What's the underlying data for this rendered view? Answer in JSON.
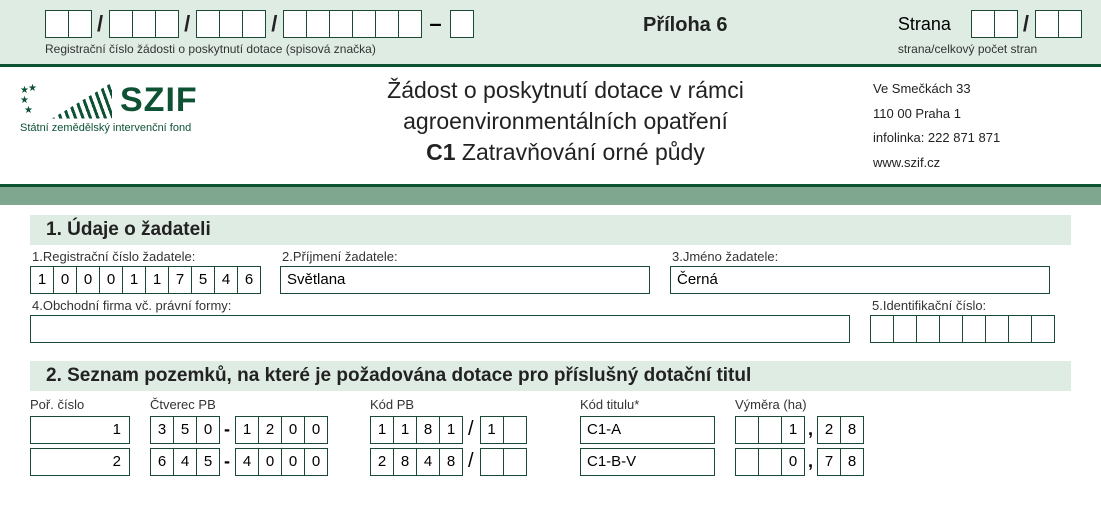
{
  "header": {
    "reg_caption": "Registrační číslo žádosti o poskytnutí dotace (spisová značka)",
    "priloha": "Příloha 6",
    "strana_label": "Strana",
    "strana_caption": "strana/celkový počet stran"
  },
  "logo": {
    "text": "SZIF",
    "sub": "Státní zemědělský intervenční fond"
  },
  "title": {
    "line1": "Žádost o poskytnutí dotace v rámci",
    "line2": "agroenvironmentálních opatření",
    "code": "C1",
    "line3_rest": " Zatravňování orné půdy"
  },
  "address": {
    "l1": "Ve Smečkách 33",
    "l2": "110 00 Praha 1",
    "l3": "infolinka: 222 871 871",
    "l4": "www.szif.cz"
  },
  "sec1": {
    "title": "1. Údaje o žadateli",
    "f1_label": "1.Registrační číslo žadatele:",
    "f1_digits": [
      "1",
      "0",
      "0",
      "0",
      "1",
      "1",
      "7",
      "5",
      "4",
      "6"
    ],
    "f2_label": "2.Příjmení žadatele:",
    "f2_value": "Světlana",
    "f3_label": "3.Jméno žadatele:",
    "f3_value": "Černá",
    "f4_label": "4.Obchodní firma vč. právní formy:",
    "f4_value": "",
    "f5_label": "5.Identifikační číslo:",
    "f5_cells": 8
  },
  "sec2": {
    "title": "2. Seznam pozemků, na které je požadována dotace pro příslušný dotační titul",
    "cols": {
      "por": "Poř. číslo",
      "ctv": "Čtverec PB",
      "kod": "Kód PB",
      "tit": "Kód titulu*",
      "vym": "Výměra (ha)"
    },
    "rows": [
      {
        "por": "1",
        "ctv_a": [
          "3",
          "5",
          "0"
        ],
        "ctv_b": [
          "1",
          "2",
          "0",
          "0"
        ],
        "kod_a": [
          "1",
          "1",
          "8",
          "1"
        ],
        "kod_b": [
          "1",
          ""
        ],
        "tit": "C1-A",
        "vym_a": [
          "",
          "",
          "1"
        ],
        "vym_b": [
          "2",
          "8"
        ]
      },
      {
        "por": "2",
        "ctv_a": [
          "6",
          "4",
          "5"
        ],
        "ctv_b": [
          "4",
          "0",
          "0",
          "0"
        ],
        "kod_a": [
          "2",
          "8",
          "4",
          "8"
        ],
        "kod_b": [
          "",
          ""
        ],
        "tit": "C1-B-V",
        "vym_a": [
          "",
          "",
          "0"
        ],
        "vym_b": [
          "7",
          "8"
        ]
      }
    ]
  }
}
